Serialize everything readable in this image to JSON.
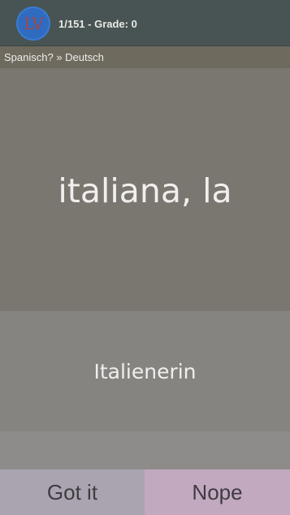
{
  "header": {
    "logo_text": "LV",
    "progress": "1/151 - Grade: 0"
  },
  "direction": {
    "label": "Spanisch? » Deutsch"
  },
  "card": {
    "question": "italiana, la",
    "answer": "Italienerin"
  },
  "actions": {
    "got_it_label": "Got it",
    "nope_label": "Nope"
  },
  "colors": {
    "topbar": "#485453",
    "langbar": "#6f6a5e",
    "question_bg": "#7a7670",
    "answer_bg": "#858480",
    "got_it_bg": "#aaa4b0",
    "nope_bg": "#c2a9c0",
    "logo_bg": "#2f6bbf"
  }
}
